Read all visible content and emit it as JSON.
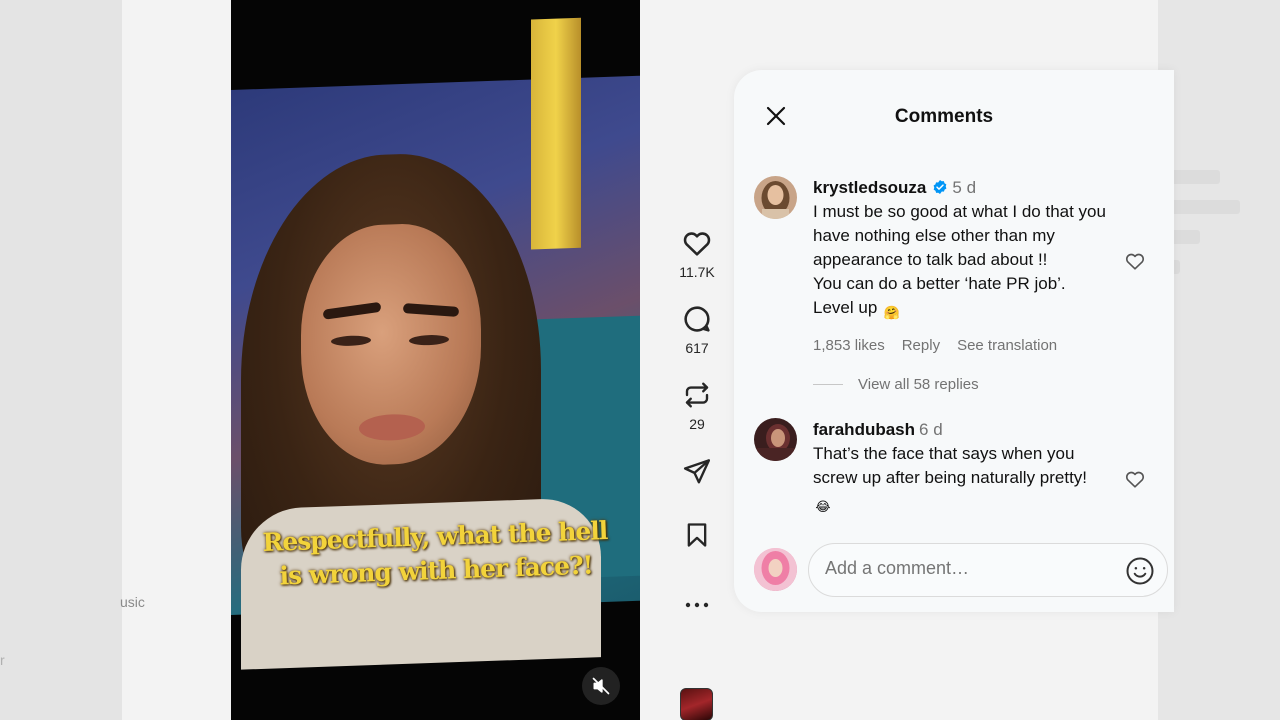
{
  "background": {
    "ghost_left_text": "usic",
    "ghost_bottom_text": "r"
  },
  "video": {
    "caption_line1": "Respectfully, what the hell",
    "caption_line2": "is wrong with her face?!",
    "mute_icon": "speaker-muted-icon"
  },
  "rail": {
    "like_count": "11.7K",
    "comment_count": "617",
    "repost_count": "29",
    "icons": [
      "heart-icon",
      "comment-bubble-icon",
      "repost-icon",
      "share-icon",
      "bookmark-icon",
      "more-icon"
    ]
  },
  "comments_panel": {
    "title": "Comments",
    "close_icon": "close-icon",
    "comments": [
      {
        "username": "krystledsouza",
        "verified": true,
        "time": "5 d",
        "text": "I must be so good at what I do that you have nothing else other than my appearance to talk bad about !!\nYou can do a better ‘hate PR job’.\nLevel up",
        "emoji": "🤗",
        "likes": "1,853 likes",
        "reply_label": "Reply",
        "translation_label": "See translation",
        "view_replies": "View all 58 replies"
      },
      {
        "username": "farahdubash",
        "verified": false,
        "time": "6 d",
        "text": "That’s the face that says when you screw up after being naturally pretty!",
        "emoji": "😂"
      }
    ],
    "add_comment_placeholder": "Add a comment…",
    "emoji_picker_icon": "smiley-icon"
  },
  "colors": {
    "verified_blue": "#0095f6",
    "caption_yellow": "#f2d33b",
    "panel_bg": "#f7f9fa",
    "muted_text": "#737373"
  }
}
